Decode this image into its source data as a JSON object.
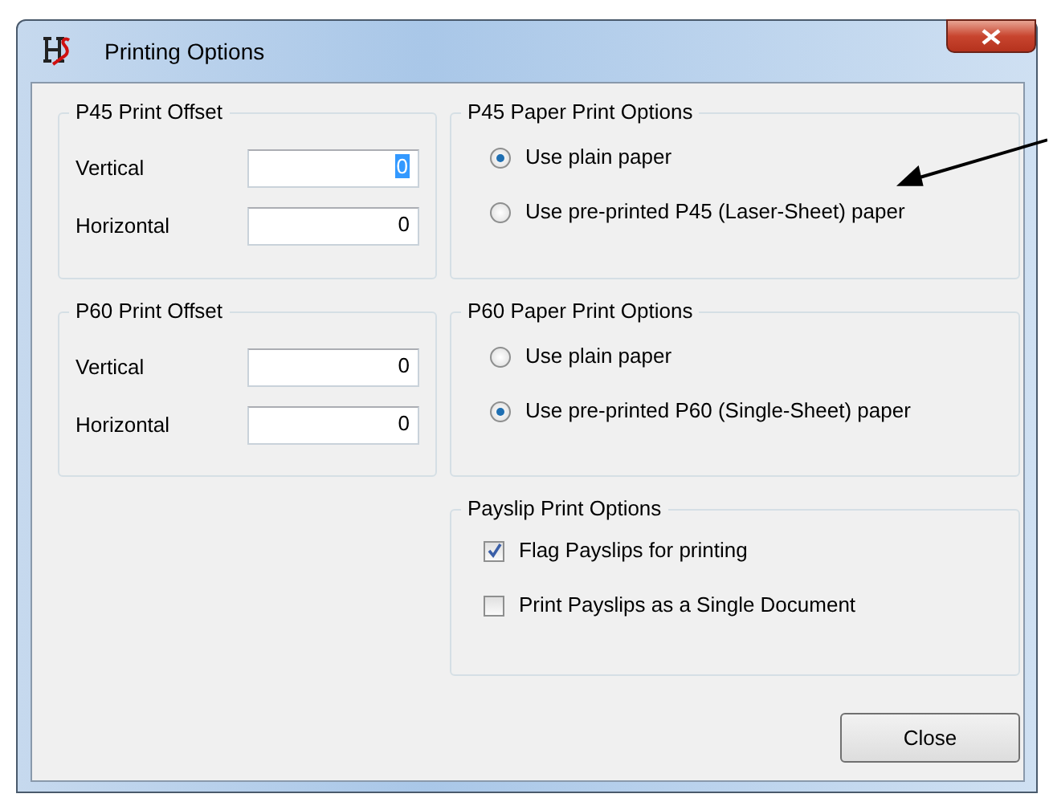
{
  "window": {
    "title": "Printing Options"
  },
  "offset_groups": [
    {
      "title": "P45 Print Offset",
      "fields": [
        {
          "label": "Vertical",
          "value": "0",
          "highlighted": true
        },
        {
          "label": "Horizontal",
          "value": "0",
          "highlighted": false
        }
      ]
    },
    {
      "title": "P60 Print Offset",
      "fields": [
        {
          "label": "Vertical",
          "value": "0",
          "highlighted": false
        },
        {
          "label": "Horizontal",
          "value": "0",
          "highlighted": false
        }
      ]
    }
  ],
  "paper_groups": [
    {
      "title": "P45 Paper Print Options",
      "options": [
        {
          "label": "Use plain paper",
          "selected": true
        },
        {
          "label": "Use pre-printed P45 (Laser-Sheet) paper",
          "selected": false
        }
      ]
    },
    {
      "title": "P60 Paper Print Options",
      "options": [
        {
          "label": "Use plain paper",
          "selected": false
        },
        {
          "label": "Use pre-printed P60 (Single-Sheet) paper",
          "selected": true
        }
      ]
    }
  ],
  "payslip_group": {
    "title": "Payslip Print Options",
    "options": [
      {
        "label": "Flag Payslips for printing",
        "checked": true
      },
      {
        "label": "Print Payslips as a Single Document",
        "checked": false
      }
    ]
  },
  "buttons": [
    "Close"
  ]
}
